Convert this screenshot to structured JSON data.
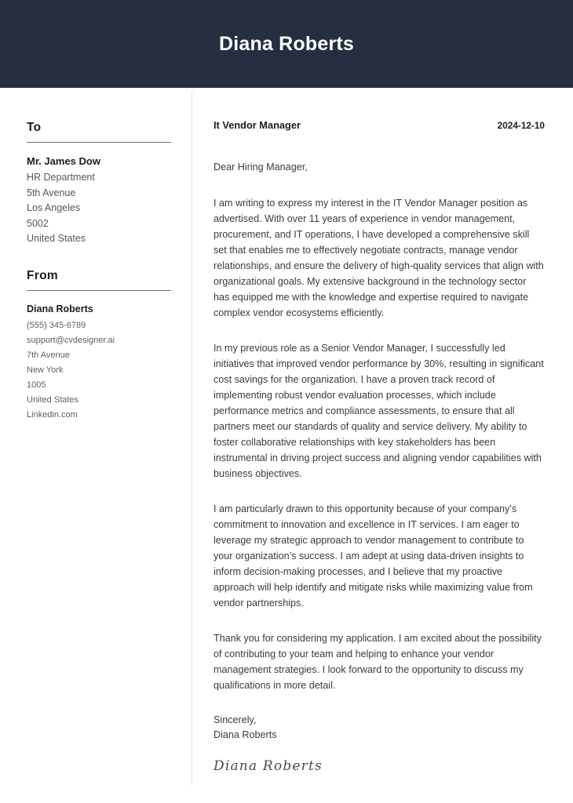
{
  "header": {
    "name": "Diana Roberts",
    "background_color": "#262f3f",
    "text_color": "#ffffff"
  },
  "sidebar": {
    "to": {
      "heading": "To",
      "name": "Mr. James Dow",
      "lines": [
        "HR Department",
        "5th Avenue",
        "Los Angeles",
        "5002",
        "United States"
      ]
    },
    "from": {
      "heading": "From",
      "name": "Diana Roberts",
      "lines": [
        "(555) 345-6789",
        "support@cvdesigner.ai",
        "7th Avenue",
        "New York",
        "1005",
        "United States",
        "Linkedin.com"
      ]
    }
  },
  "letter": {
    "job_title": "It Vendor Manager",
    "date": "2024-12-10",
    "salutation": "Dear Hiring Manager,",
    "paragraphs": [
      "I am writing to express my interest in the IT Vendor Manager position as advertised. With over 11 years of experience in vendor management, procurement, and IT operations, I have developed a comprehensive skill set that enables me to effectively negotiate contracts, manage vendor relationships, and ensure the delivery of high-quality services that align with organizational goals. My extensive background in the technology sector has equipped me with the knowledge and expertise required to navigate complex vendor ecosystems efficiently.",
      "In my previous role as a Senior Vendor Manager, I successfully led initiatives that improved vendor performance by 30%, resulting in significant cost savings for the organization. I have a proven track record of implementing robust vendor evaluation processes, which include performance metrics and compliance assessments, to ensure that all partners meet our standards of quality and service delivery. My ability to foster collaborative relationships with key stakeholders has been instrumental in driving project success and aligning vendor capabilities with business objectives.",
      "I am particularly drawn to this opportunity because of your company’s commitment to innovation and excellence in IT services. I am eager to leverage my strategic approach to vendor management to contribute to your organization’s success. I am adept at using data-driven insights to inform decision-making processes, and I believe that my proactive approach will help identify and mitigate risks while maximizing value from vendor partnerships.",
      "Thank you for considering my application. I am excited about the possibility of contributing to your team and helping to enhance your vendor management strategies. I look forward to the opportunity to discuss my qualifications in more detail."
    ],
    "closing_salutation": "Sincerely,",
    "closing_name": "Diana Roberts",
    "signature": "Diana Roberts"
  }
}
